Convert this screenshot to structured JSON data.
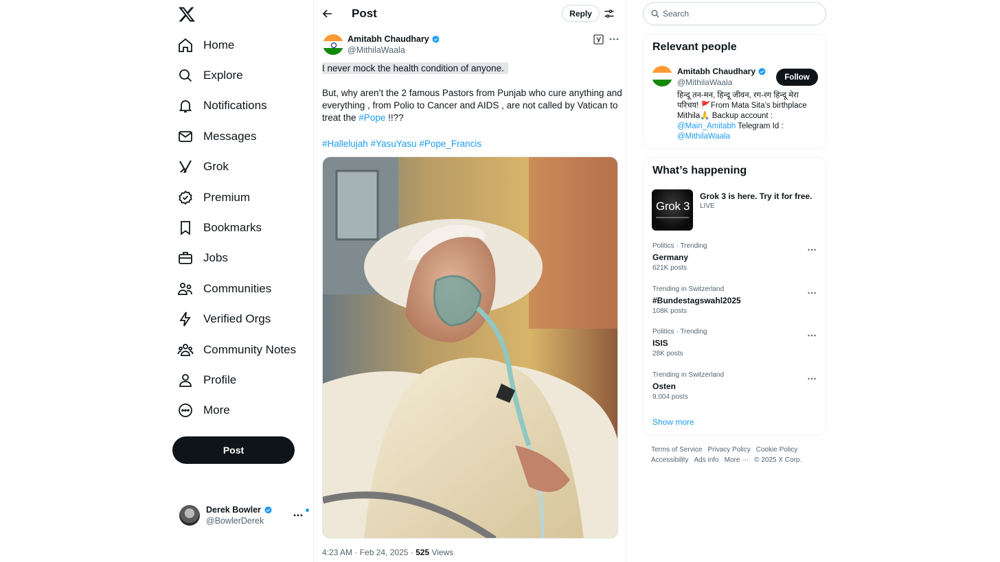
{
  "nav": {
    "items": [
      {
        "label": "Home",
        "icon": "home-icon"
      },
      {
        "label": "Explore",
        "icon": "search-icon"
      },
      {
        "label": "Notifications",
        "icon": "bell-icon"
      },
      {
        "label": "Messages",
        "icon": "envelope-icon"
      },
      {
        "label": "Grok",
        "icon": "grok-icon"
      },
      {
        "label": "Premium",
        "icon": "premium-icon"
      },
      {
        "label": "Bookmarks",
        "icon": "bookmark-icon"
      },
      {
        "label": "Jobs",
        "icon": "briefcase-icon"
      },
      {
        "label": "Communities",
        "icon": "communities-icon"
      },
      {
        "label": "Verified Orgs",
        "icon": "lightning-icon"
      },
      {
        "label": "Community Notes",
        "icon": "community-notes-icon"
      },
      {
        "label": "Profile",
        "icon": "person-icon"
      },
      {
        "label": "More",
        "icon": "more-circle-icon"
      }
    ],
    "post_button": "Post"
  },
  "account": {
    "name": "Derek Bowler",
    "handle": "@BowlerDerek"
  },
  "header": {
    "title": "Post",
    "reply_button": "Reply"
  },
  "post": {
    "author_name": "Amitabh Chaudhary",
    "author_handle": "@MithilaWaala",
    "line1": "I never mock the health condition of anyone.",
    "line2": "But, why aren’t the 2 famous Pastors from Punjab who cure anything and everything , from Polio to Cancer and AIDS , are not called by Vatican to treat the",
    "hashtag_pope": "#Pope",
    "line2_end": " !!??",
    "hashtags": [
      "#Hallelujah",
      "#YasuYasu",
      "#Pope_Francis"
    ],
    "timestamp": "4:23 AM · Feb 24, 2025 · ",
    "views_count": "525",
    "views_label": " Views"
  },
  "search": {
    "placeholder": "Search"
  },
  "relevant": {
    "heading": "Relevant people",
    "name": "Amitabh Chaudhary",
    "handle": "@MithilaWaala",
    "follow": "Follow",
    "bio_1": "हिन्दू तन-मन, हिन्दू जीवन, रग-रग हिन्दू मेरा परिचय! 🚩From Mata Sita’s birthplace Mithila🙏 Backup account : ",
    "bio_link1": "@Main_Amitabh",
    "bio_2": " Telegram Id : ",
    "bio_link2": "@MithilaWaala"
  },
  "happening": {
    "heading": "What’s happening",
    "promo_title": "Grok 3 is here. Try it for free.",
    "promo_live": "LIVE",
    "promo_thumb": "Grok 3",
    "trends": [
      {
        "context": "Politics · Trending",
        "title": "Germany",
        "posts": "621K posts"
      },
      {
        "context": "Trending in Switzerland",
        "title": "#Bundestagswahl2025",
        "posts": "108K posts"
      },
      {
        "context": "Politics · Trending",
        "title": "ISIS",
        "posts": "28K posts"
      },
      {
        "context": "Trending in Switzerland",
        "title": "Osten",
        "posts": "9,004 posts"
      }
    ],
    "show_more": "Show more"
  },
  "footer": {
    "links": [
      "Terms of Service",
      "Privacy Policy",
      "Cookie Policy",
      "Accessibility",
      "Ads info",
      "More ···"
    ],
    "copyright": "© 2025 X Corp."
  },
  "colors": {
    "accent": "#1d9bf0",
    "text": "#0f1419",
    "muted": "#536471",
    "button_dark": "#0f1419"
  }
}
